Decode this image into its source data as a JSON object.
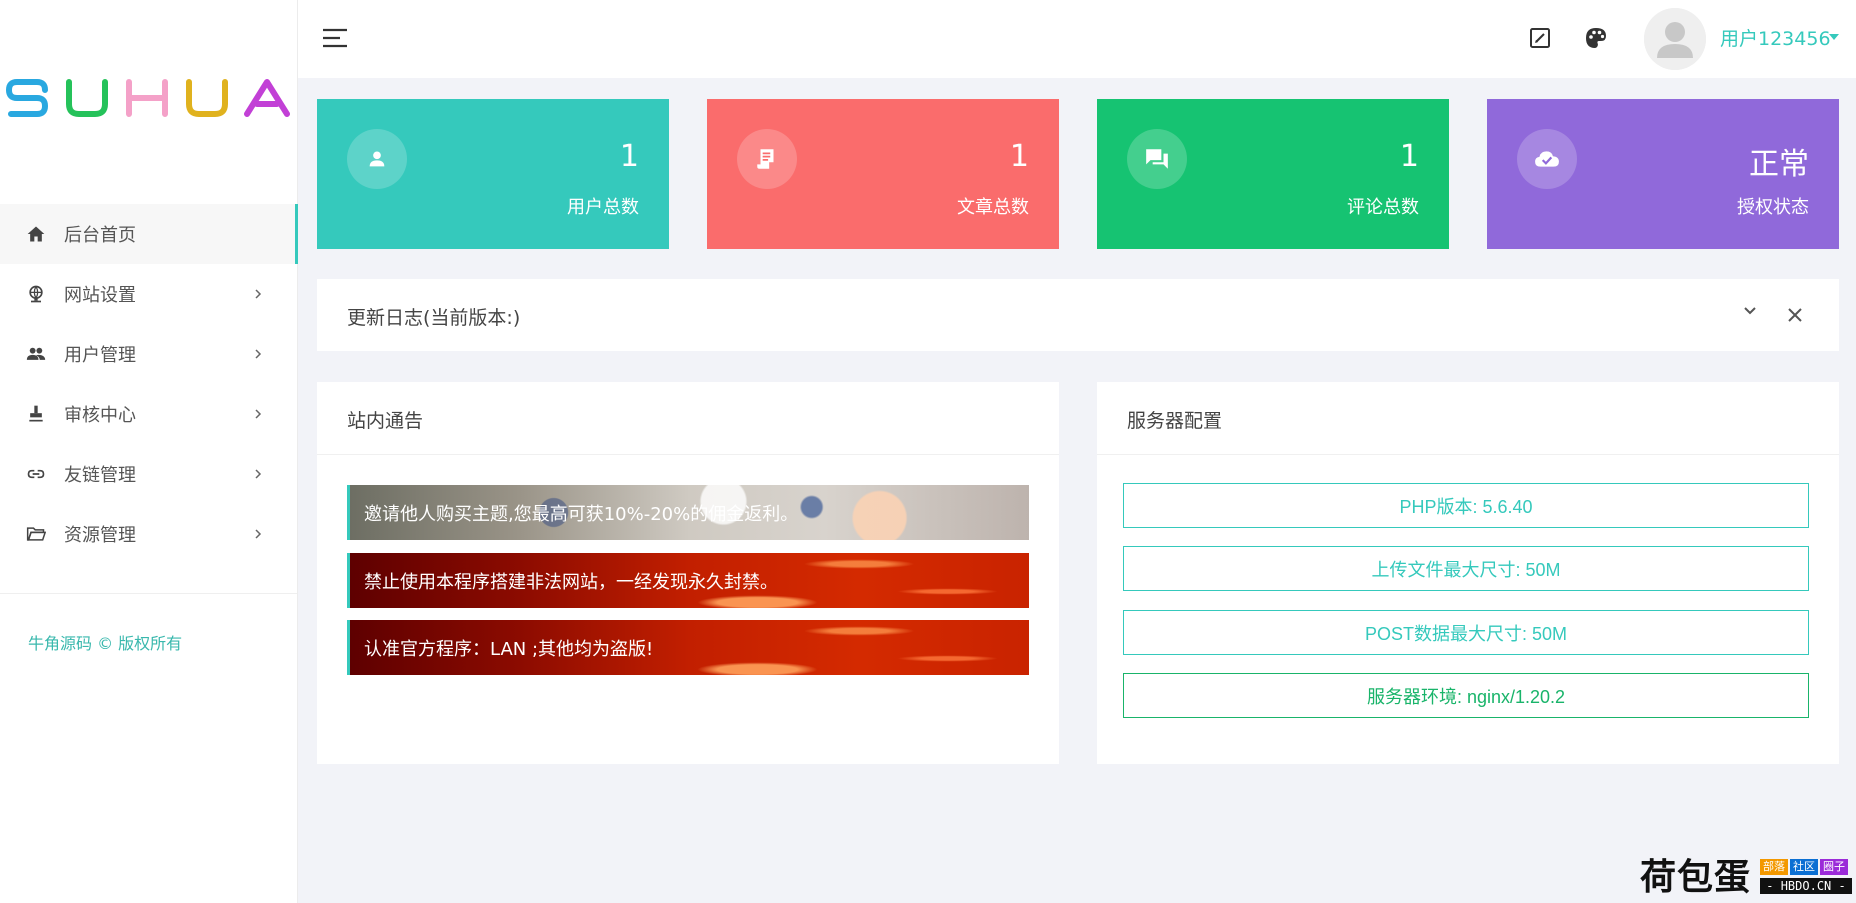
{
  "brand": {
    "logo_text": "SUHUA",
    "colors": [
      "#29a8e0",
      "#25c25a",
      "#f4a1c8",
      "#e0b21e",
      "#c240d6"
    ]
  },
  "sidebar": {
    "items": [
      {
        "label": "后台首页",
        "icon": "home-icon",
        "active": true
      },
      {
        "label": "网站设置",
        "icon": "globe-icon",
        "active": false
      },
      {
        "label": "用户管理",
        "icon": "users-icon",
        "active": false
      },
      {
        "label": "审核中心",
        "icon": "stamp-icon",
        "active": false
      },
      {
        "label": "友链管理",
        "icon": "link-icon",
        "active": false
      },
      {
        "label": "资源管理",
        "icon": "folder-icon",
        "active": false
      }
    ],
    "copyright": "牛角源码 © 版权所有"
  },
  "header": {
    "menu_icon": "menu-icon",
    "edit_icon": "edit-icon",
    "theme_icon": "palette-icon",
    "username": "用户123456"
  },
  "stats": [
    {
      "value": "1",
      "label": "用户总数",
      "icon": "user-icon",
      "color": "#35c9bc"
    },
    {
      "value": "1",
      "label": "文章总数",
      "icon": "article-icon",
      "color": "#fa6c6c"
    },
    {
      "value": "1",
      "label": "评论总数",
      "icon": "comment-icon",
      "color": "#16c372"
    },
    {
      "value": "正常",
      "label": "授权状态",
      "icon": "cloud-check-icon",
      "color": "#9069da"
    }
  ],
  "changelog": {
    "title": "更新日志(当前版本:)"
  },
  "notices": {
    "title": "站内通告",
    "items": [
      "邀请他人购买主题,您最高可获10%-20%的佣金返利。",
      "禁止使用本程序搭建非法网站，一经发现永久封禁。",
      "认准官方程序：LAN ;其他均为盗版!"
    ]
  },
  "server": {
    "title": "服务器配置",
    "rows": [
      "PHP版本: 5.6.40",
      "上传文件最大尺寸: 50M",
      "POST数据最大尺寸: 50M",
      "服务器环境: nginx/1.20.2"
    ]
  },
  "watermark": {
    "main": "荷包蛋",
    "tags": [
      "部落",
      "社区",
      "圈子"
    ],
    "sub": "- HBDO.CN -"
  }
}
